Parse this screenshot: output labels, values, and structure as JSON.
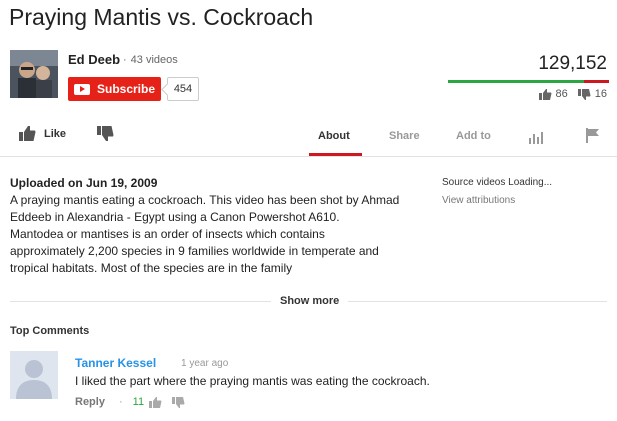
{
  "video": {
    "title": "Praying Mantis vs. Cockroach",
    "views": "129,152",
    "likes": "86",
    "dislikes": "16",
    "like_ratio": 0.843
  },
  "channel": {
    "name": "Ed Deeb",
    "separator": "·",
    "video_count": "43 videos",
    "subscribe_label": "Subscribe",
    "subscriber_count": "454"
  },
  "actions": {
    "like_label": "Like",
    "tabs": [
      "About",
      "Share",
      "Add to"
    ],
    "active_tab": "About"
  },
  "description": {
    "upload_date": "Uploaded on Jun 19, 2009",
    "paragraph1": "A praying mantis eating a cockroach. This video has been shot by Ahmad Eddeeb in Alexandria - Egypt using a Canon Powershot A610.",
    "paragraph2": "Mantodea or mantises is an order of insects which contains approximately 2,200 species in 9 families worldwide in temperate and tropical habitats. Most of the species are in the family",
    "source_videos": "Source videos Loading...",
    "view_attributions": "View attributions",
    "show_more": "Show more"
  },
  "comments": {
    "heading": "Top Comments",
    "items": [
      {
        "author": "Tanner Kessel",
        "time": "1 year ago",
        "text": "I liked the part where the praying mantis was eating the cockroach.",
        "reply_label": "Reply",
        "separator": "·",
        "likes": "11"
      }
    ]
  },
  "colors": {
    "subscribe_red": "#e62117",
    "like_green": "#2ba640",
    "dislike_red": "#cc181e",
    "author_blue": "#2793e6",
    "active_tab_underline": "#cc181e"
  },
  "icons": [
    "thumbs-up-icon",
    "thumbs-down-icon",
    "youtube-logo-icon",
    "stats-icon",
    "flag-icon",
    "default-avatar-icon"
  ]
}
